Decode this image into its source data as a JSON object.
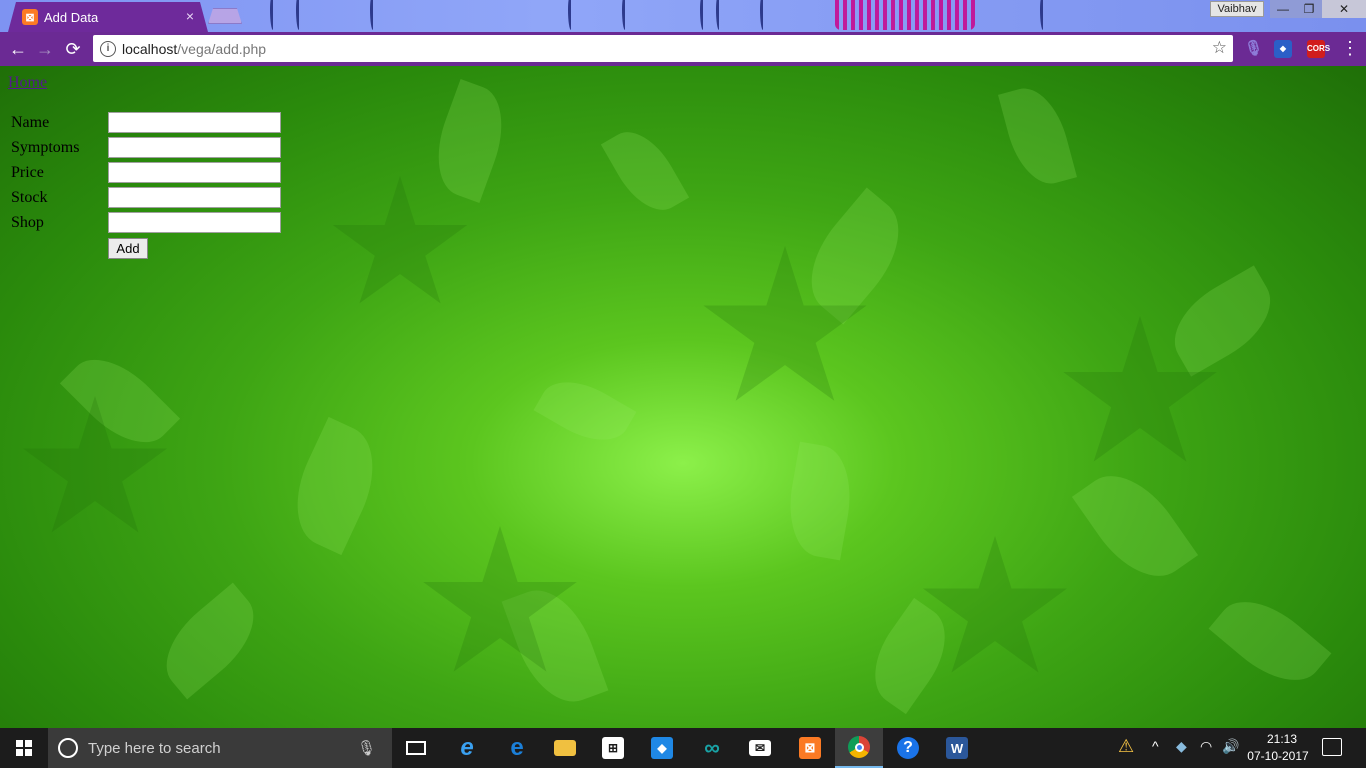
{
  "browser": {
    "tab_title": "Add Data",
    "tab_close": "×",
    "profile_name": "Vaibhav",
    "window_controls": {
      "minimize": "—",
      "maximize": "❐",
      "close": "✕"
    },
    "url_host": "localhost",
    "url_path": "/vega/add.php",
    "nav": {
      "back": "←",
      "forward": "→",
      "reload": "⟳"
    },
    "extensions": {
      "cors_label": "CORS"
    },
    "menu": "⋮"
  },
  "page": {
    "home_link": "Home",
    "form": {
      "fields": [
        {
          "label": "Name",
          "value": ""
        },
        {
          "label": "Symptoms",
          "value": ""
        },
        {
          "label": "Price",
          "value": ""
        },
        {
          "label": "Stock",
          "value": ""
        },
        {
          "label": "Shop",
          "value": ""
        }
      ],
      "submit_label": "Add"
    }
  },
  "taskbar": {
    "search_placeholder": "Type here to search",
    "apps": [
      "task-view-icon",
      "internet-explorer-icon",
      "edge-icon",
      "file-explorer-icon",
      "store-icon",
      "dropbox-icon",
      "arduino-icon",
      "mail-icon",
      "xampp-icon",
      "chrome-icon",
      "help-icon",
      "word-icon"
    ],
    "clock": {
      "time": "21:13",
      "date": "07-10-2017"
    }
  },
  "colors": {
    "tab_bg": "#6e2a9b",
    "toolbar_bg": "#6b2a94",
    "page_bg_center": "#8cf04a",
    "page_bg_edge": "#1f6f08",
    "link_visited": "#551a8b",
    "taskbar_bg": "#1c1c1c"
  }
}
